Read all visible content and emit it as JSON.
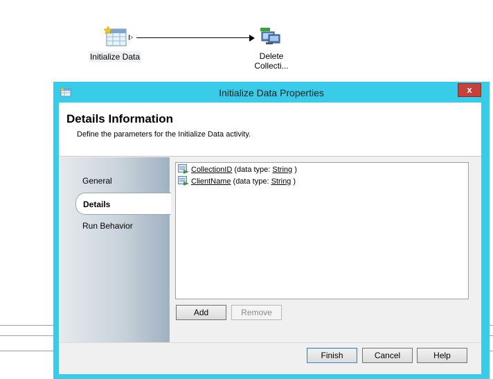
{
  "workflow": {
    "nodes": [
      {
        "label": "Initialize Data",
        "icon": "initialize-data-icon"
      },
      {
        "label": "Delete\nCollecti...",
        "icon": "delete-collection-icon"
      }
    ]
  },
  "dialog": {
    "title": "Initialize Data Properties",
    "close_label": "x",
    "header": {
      "title": "Details Information",
      "subtitle": "Define the parameters for the Initialize Data activity."
    },
    "nav": {
      "items": [
        {
          "label": "General"
        },
        {
          "label": "Details",
          "selected": true
        },
        {
          "label": "Run Behavior"
        }
      ]
    },
    "parameters": [
      {
        "name": "CollectionID",
        "prefix": " (data type: ",
        "type": "String",
        "suffix": " )"
      },
      {
        "name": "ClientName",
        "prefix": " (data type: ",
        "type": "String",
        "suffix": " )"
      }
    ],
    "buttons": {
      "add": "Add",
      "remove": "Remove",
      "finish": "Finish",
      "cancel": "Cancel",
      "help": "Help"
    }
  },
  "colors": {
    "window_frame": "#38cce9",
    "close_button": "#c7413b"
  }
}
